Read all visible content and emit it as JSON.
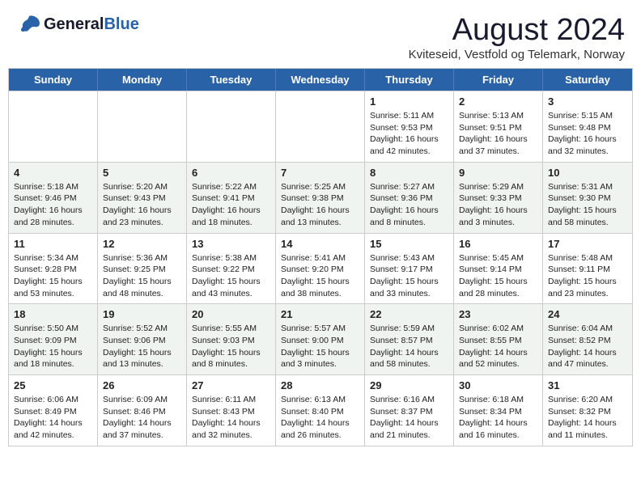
{
  "header": {
    "logo_general": "General",
    "logo_blue": "Blue",
    "main_title": "August 2024",
    "subtitle": "Kviteseid, Vestfold og Telemark, Norway"
  },
  "calendar": {
    "days": [
      "Sunday",
      "Monday",
      "Tuesday",
      "Wednesday",
      "Thursday",
      "Friday",
      "Saturday"
    ],
    "rows": [
      {
        "cells": [
          {
            "date": "",
            "info": ""
          },
          {
            "date": "",
            "info": ""
          },
          {
            "date": "",
            "info": ""
          },
          {
            "date": "",
            "info": ""
          },
          {
            "date": "1",
            "info": "Sunrise: 5:11 AM\nSunset: 9:53 PM\nDaylight: 16 hours\nand 42 minutes."
          },
          {
            "date": "2",
            "info": "Sunrise: 5:13 AM\nSunset: 9:51 PM\nDaylight: 16 hours\nand 37 minutes."
          },
          {
            "date": "3",
            "info": "Sunrise: 5:15 AM\nSunset: 9:48 PM\nDaylight: 16 hours\nand 32 minutes."
          }
        ]
      },
      {
        "cells": [
          {
            "date": "4",
            "info": "Sunrise: 5:18 AM\nSunset: 9:46 PM\nDaylight: 16 hours\nand 28 minutes."
          },
          {
            "date": "5",
            "info": "Sunrise: 5:20 AM\nSunset: 9:43 PM\nDaylight: 16 hours\nand 23 minutes."
          },
          {
            "date": "6",
            "info": "Sunrise: 5:22 AM\nSunset: 9:41 PM\nDaylight: 16 hours\nand 18 minutes."
          },
          {
            "date": "7",
            "info": "Sunrise: 5:25 AM\nSunset: 9:38 PM\nDaylight: 16 hours\nand 13 minutes."
          },
          {
            "date": "8",
            "info": "Sunrise: 5:27 AM\nSunset: 9:36 PM\nDaylight: 16 hours\nand 8 minutes."
          },
          {
            "date": "9",
            "info": "Sunrise: 5:29 AM\nSunset: 9:33 PM\nDaylight: 16 hours\nand 3 minutes."
          },
          {
            "date": "10",
            "info": "Sunrise: 5:31 AM\nSunset: 9:30 PM\nDaylight: 15 hours\nand 58 minutes."
          }
        ]
      },
      {
        "cells": [
          {
            "date": "11",
            "info": "Sunrise: 5:34 AM\nSunset: 9:28 PM\nDaylight: 15 hours\nand 53 minutes."
          },
          {
            "date": "12",
            "info": "Sunrise: 5:36 AM\nSunset: 9:25 PM\nDaylight: 15 hours\nand 48 minutes."
          },
          {
            "date": "13",
            "info": "Sunrise: 5:38 AM\nSunset: 9:22 PM\nDaylight: 15 hours\nand 43 minutes."
          },
          {
            "date": "14",
            "info": "Sunrise: 5:41 AM\nSunset: 9:20 PM\nDaylight: 15 hours\nand 38 minutes."
          },
          {
            "date": "15",
            "info": "Sunrise: 5:43 AM\nSunset: 9:17 PM\nDaylight: 15 hours\nand 33 minutes."
          },
          {
            "date": "16",
            "info": "Sunrise: 5:45 AM\nSunset: 9:14 PM\nDaylight: 15 hours\nand 28 minutes."
          },
          {
            "date": "17",
            "info": "Sunrise: 5:48 AM\nSunset: 9:11 PM\nDaylight: 15 hours\nand 23 minutes."
          }
        ]
      },
      {
        "cells": [
          {
            "date": "18",
            "info": "Sunrise: 5:50 AM\nSunset: 9:09 PM\nDaylight: 15 hours\nand 18 minutes."
          },
          {
            "date": "19",
            "info": "Sunrise: 5:52 AM\nSunset: 9:06 PM\nDaylight: 15 hours\nand 13 minutes."
          },
          {
            "date": "20",
            "info": "Sunrise: 5:55 AM\nSunset: 9:03 PM\nDaylight: 15 hours\nand 8 minutes."
          },
          {
            "date": "21",
            "info": "Sunrise: 5:57 AM\nSunset: 9:00 PM\nDaylight: 15 hours\nand 3 minutes."
          },
          {
            "date": "22",
            "info": "Sunrise: 5:59 AM\nSunset: 8:57 PM\nDaylight: 14 hours\nand 58 minutes."
          },
          {
            "date": "23",
            "info": "Sunrise: 6:02 AM\nSunset: 8:55 PM\nDaylight: 14 hours\nand 52 minutes."
          },
          {
            "date": "24",
            "info": "Sunrise: 6:04 AM\nSunset: 8:52 PM\nDaylight: 14 hours\nand 47 minutes."
          }
        ]
      },
      {
        "cells": [
          {
            "date": "25",
            "info": "Sunrise: 6:06 AM\nSunset: 8:49 PM\nDaylight: 14 hours\nand 42 minutes."
          },
          {
            "date": "26",
            "info": "Sunrise: 6:09 AM\nSunset: 8:46 PM\nDaylight: 14 hours\nand 37 minutes."
          },
          {
            "date": "27",
            "info": "Sunrise: 6:11 AM\nSunset: 8:43 PM\nDaylight: 14 hours\nand 32 minutes."
          },
          {
            "date": "28",
            "info": "Sunrise: 6:13 AM\nSunset: 8:40 PM\nDaylight: 14 hours\nand 26 minutes."
          },
          {
            "date": "29",
            "info": "Sunrise: 6:16 AM\nSunset: 8:37 PM\nDaylight: 14 hours\nand 21 minutes."
          },
          {
            "date": "30",
            "info": "Sunrise: 6:18 AM\nSunset: 8:34 PM\nDaylight: 14 hours\nand 16 minutes."
          },
          {
            "date": "31",
            "info": "Sunrise: 6:20 AM\nSunset: 8:32 PM\nDaylight: 14 hours\nand 11 minutes."
          }
        ]
      }
    ]
  }
}
